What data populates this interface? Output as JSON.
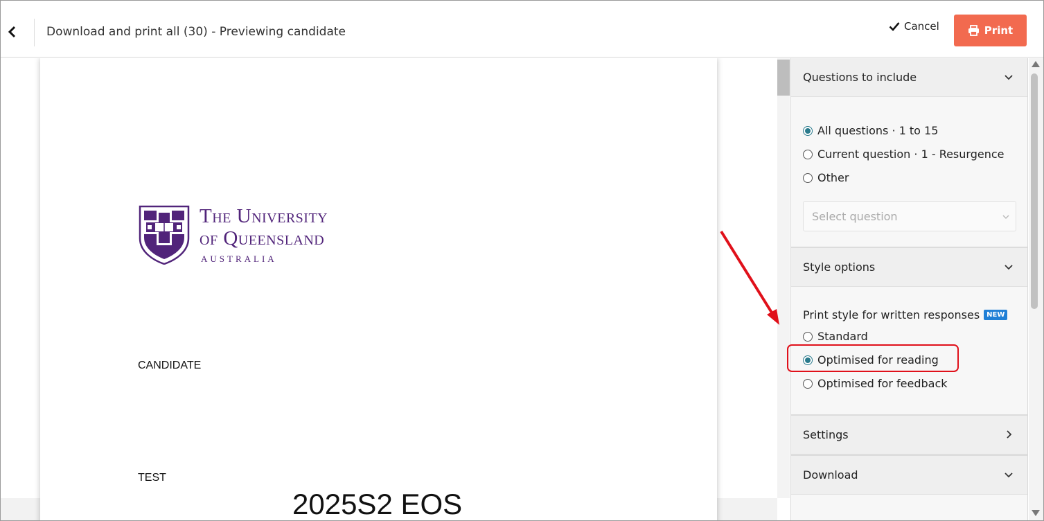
{
  "header": {
    "title": "Download and print all (30) - Previewing candidate",
    "cancel_label": "Cancel",
    "print_label": "Print"
  },
  "document": {
    "university_line1": "The University",
    "university_line2": "of Queensland",
    "university_line3": "AUSTRALIA",
    "candidate_label": "CANDIDATE",
    "test_label": "TEST",
    "exam_title": "2025S2 EOS"
  },
  "panel": {
    "questions": {
      "title": "Questions to include",
      "options": [
        {
          "label": "All questions · 1 to 15",
          "checked": true
        },
        {
          "label": "Current question · 1 - Resurgence",
          "checked": false
        },
        {
          "label": "Other",
          "checked": false
        }
      ],
      "select_placeholder": "Select question"
    },
    "style": {
      "title": "Style options",
      "label": "Print style for written responses",
      "badge": "NEW",
      "options": [
        {
          "label": "Standard",
          "checked": false
        },
        {
          "label": "Optimised for reading",
          "checked": true
        },
        {
          "label": "Optimised for feedback",
          "checked": false
        }
      ]
    },
    "settings": {
      "title": "Settings"
    },
    "download": {
      "title": "Download"
    }
  },
  "colors": {
    "print_button": "#f26a4f",
    "radio_checked": "#2a7a8c",
    "brand_purple": "#51247a",
    "annotation_red": "#e0101a",
    "badge_blue": "#1f7fd6"
  }
}
